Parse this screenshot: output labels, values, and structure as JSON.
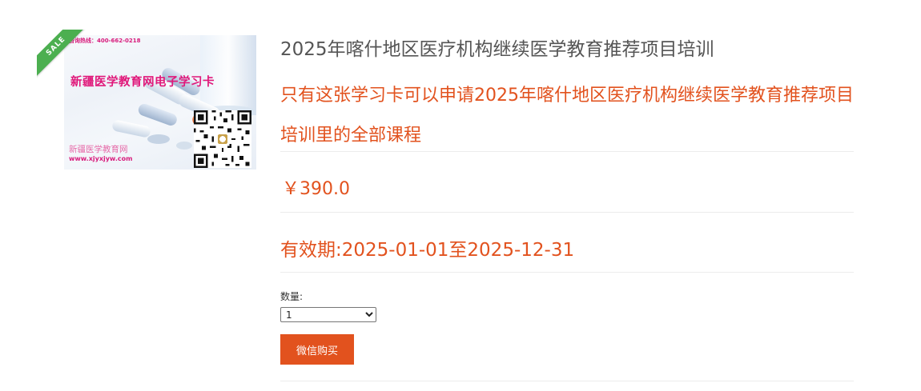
{
  "product": {
    "image": {
      "hotline": "咨询热线：400-662-0218",
      "card_title": "新疆医学教育网电子学习卡",
      "brand": "新疆医学教育网",
      "url": "www.xjyxjyw.com",
      "sale_badge": "SALE"
    },
    "title": "2025年喀什地区医疗机构继续医学教育推荐项目培训",
    "description": "只有这张学习卡可以申请2025年喀什地区医疗机构继续医学教育推荐项目培训里的全部课程",
    "price": "￥390.0",
    "validity": "有效期:2025-01-01至2025-12-31",
    "quantity": {
      "label": "数量:",
      "selected": "1",
      "options": [
        "1"
      ]
    },
    "buy_button_label": "微信购买"
  },
  "colors": {
    "accent": "#e2521e",
    "title": "#555555",
    "sale_badge": "#4caf50",
    "card_pink": "#e0187a"
  }
}
